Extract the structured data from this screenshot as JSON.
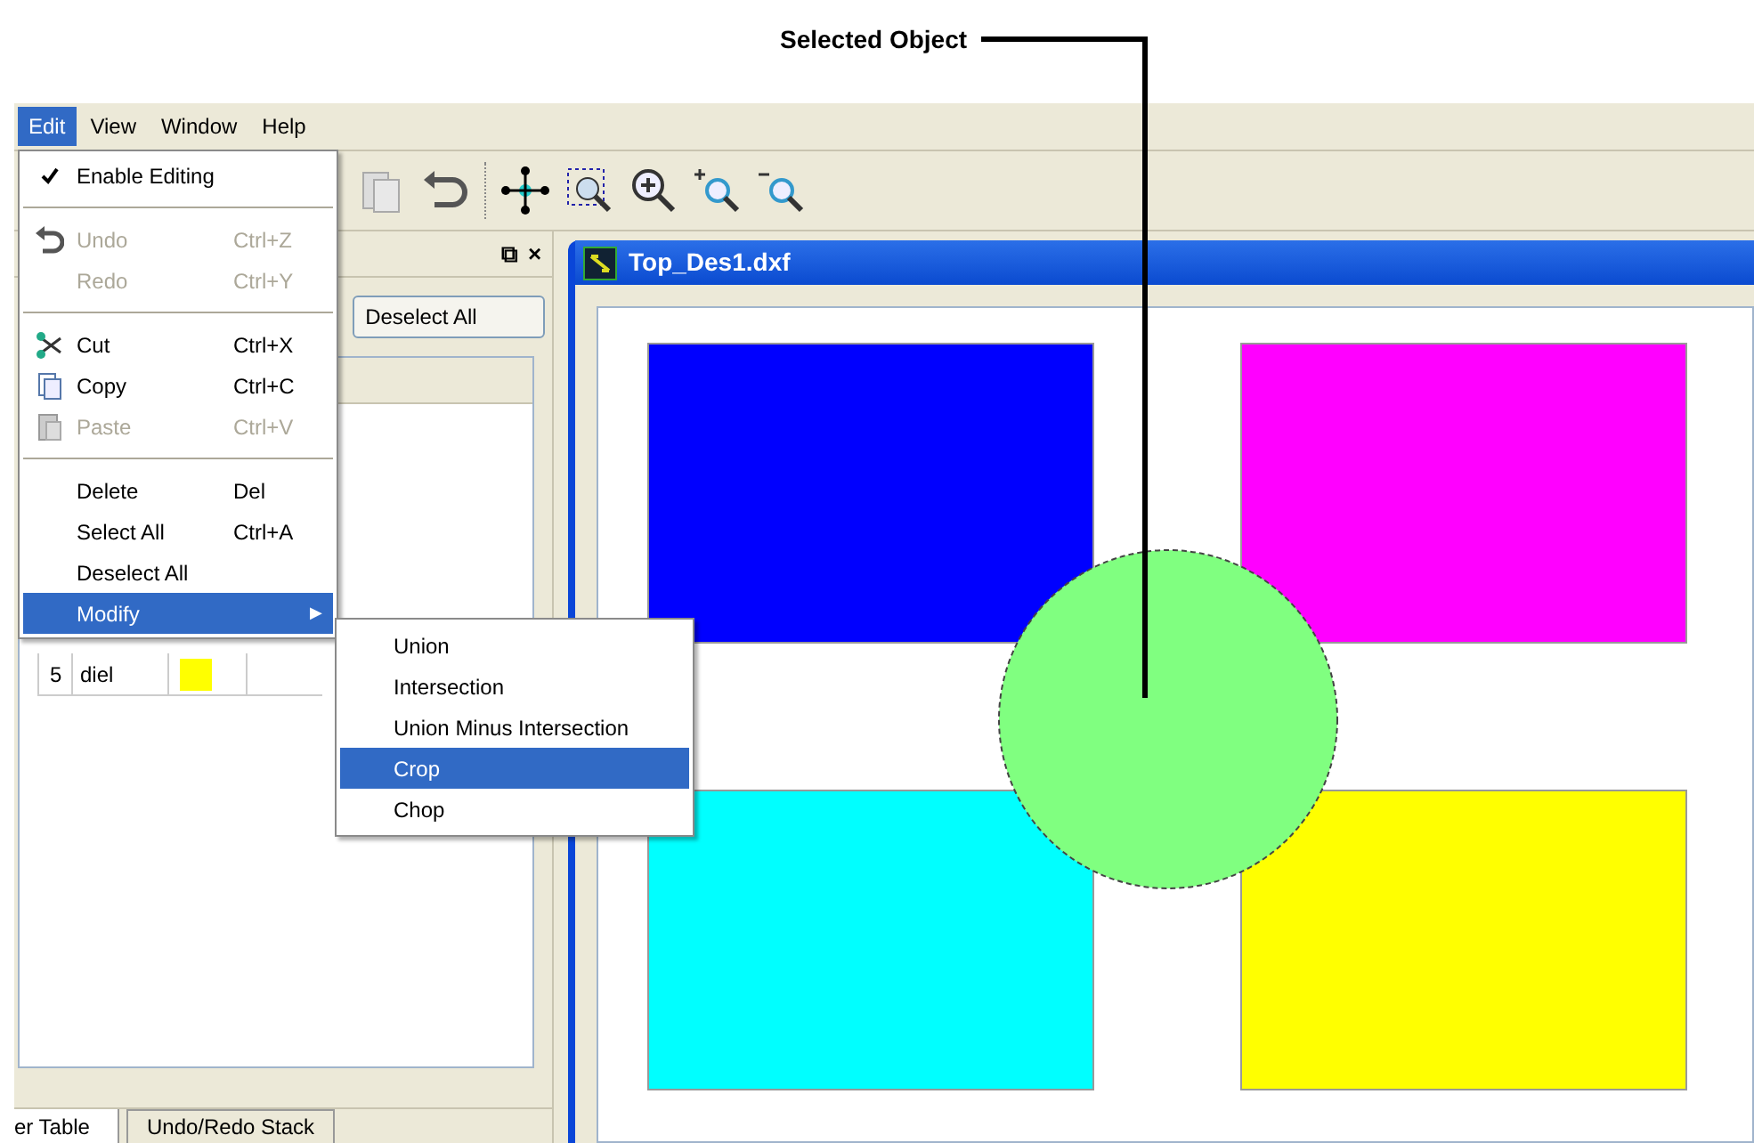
{
  "annotation": {
    "label": "Selected Object"
  },
  "menubar": [
    {
      "label": "Edit",
      "selected": true
    },
    {
      "label": "View",
      "selected": false
    },
    {
      "label": "Window",
      "selected": false
    },
    {
      "label": "Help",
      "selected": false
    }
  ],
  "edit_menu": [
    {
      "kind": "item",
      "label": "Enable Editing",
      "checked": true,
      "disabled": false,
      "selected": false
    },
    {
      "kind": "separator"
    },
    {
      "kind": "item",
      "label": "Undo",
      "shortcut": "Ctrl+Z",
      "checked": false,
      "disabled": true,
      "selected": false
    },
    {
      "kind": "item",
      "label": "Redo",
      "shortcut": "Ctrl+Y",
      "checked": false,
      "disabled": true,
      "selected": false
    },
    {
      "kind": "separator"
    },
    {
      "kind": "item",
      "label": "Cut",
      "shortcut": "Ctrl+X",
      "checked": false,
      "disabled": false,
      "selected": false
    },
    {
      "kind": "item",
      "label": "Copy",
      "shortcut": "Ctrl+C",
      "checked": false,
      "disabled": false,
      "selected": false
    },
    {
      "kind": "item",
      "label": "Paste",
      "shortcut": "Ctrl+V",
      "checked": false,
      "disabled": true,
      "selected": false
    },
    {
      "kind": "separator"
    },
    {
      "kind": "item",
      "label": "Delete",
      "shortcut": "Del",
      "checked": false,
      "disabled": false,
      "selected": false
    },
    {
      "kind": "item",
      "label": "Select All",
      "shortcut": "Ctrl+A",
      "checked": false,
      "disabled": false,
      "selected": false
    },
    {
      "kind": "item",
      "label": "Deselect All",
      "checked": false,
      "disabled": false,
      "selected": false
    },
    {
      "kind": "submenu",
      "label": "Modify",
      "arrow": "▶",
      "checked": false,
      "disabled": false,
      "selected": true
    }
  ],
  "modify_submenu": [
    {
      "label": "Union",
      "selected": false
    },
    {
      "label": "Intersection",
      "selected": false
    },
    {
      "label": "Union Minus Intersection",
      "selected": false
    },
    {
      "label": "Crop",
      "selected": true
    },
    {
      "label": "Chop",
      "selected": false
    }
  ],
  "left_panel": {
    "buttons": [
      "⧉",
      "×"
    ],
    "deselect_button": "Deselect All",
    "rows": [
      {
        "column_1": "5",
        "column_2": "diel",
        "color": "#ffff00"
      }
    ],
    "tabs": [
      {
        "label": "er Table",
        "selected": true
      },
      {
        "label": "Undo/Redo Stack",
        "selected": false
      }
    ]
  },
  "document": {
    "title": "Top_Des1.dxf",
    "shapes": [
      {
        "kind": "rect",
        "color": "#0000ff",
        "selected": false
      },
      {
        "kind": "rect",
        "color": "#ff00ff",
        "selected": false
      },
      {
        "kind": "rect",
        "color": "#00ffff",
        "selected": false
      },
      {
        "kind": "rect",
        "color": "#ffff00",
        "selected": false
      },
      {
        "kind": "circle",
        "color": "#80ff80",
        "selected": true
      }
    ]
  }
}
